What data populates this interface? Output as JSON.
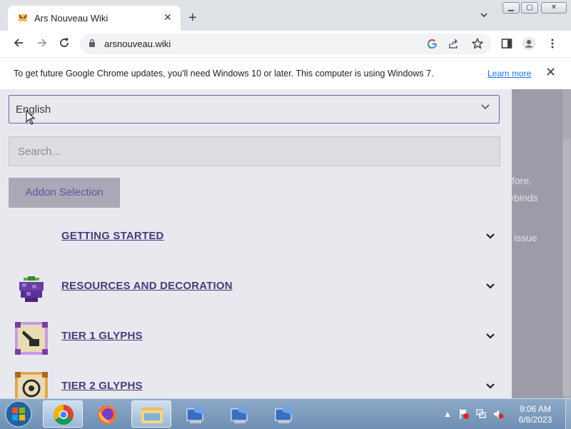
{
  "browser": {
    "tab_title": "Ars Nouveau Wiki",
    "tab_close": "✕",
    "new_tab": "+",
    "url": "arsnouveau.wiki"
  },
  "infobar": {
    "message": "To get future Google Chrome updates, you'll need Windows 10 or later. This computer is using Windows 7.",
    "learn_more": "Learn more",
    "close": "✕"
  },
  "sidebar": {
    "language": "English",
    "search_placeholder": "Search...",
    "addon_button": "Addon Selection",
    "categories": [
      {
        "label": "GETTING STARTED",
        "icon": "none"
      },
      {
        "label": "RESOURCES AND DECORATION",
        "icon": "grape-icon"
      },
      {
        "label": "TIER 1 GLYPHS",
        "icon": "glyph-tier1-icon"
      },
      {
        "label": "TIER 2 GLYPHS",
        "icon": "glyph-tier2-icon"
      }
    ]
  },
  "background_text": [
    "fore,",
    "ybinds",
    "issue"
  ],
  "taskbar": {
    "time": "9:06 AM",
    "date": "6/8/2023"
  },
  "colors": {
    "accent": "#4a3a7a",
    "select_border": "#7e5da8",
    "infobar_link": "#1a73e8"
  }
}
